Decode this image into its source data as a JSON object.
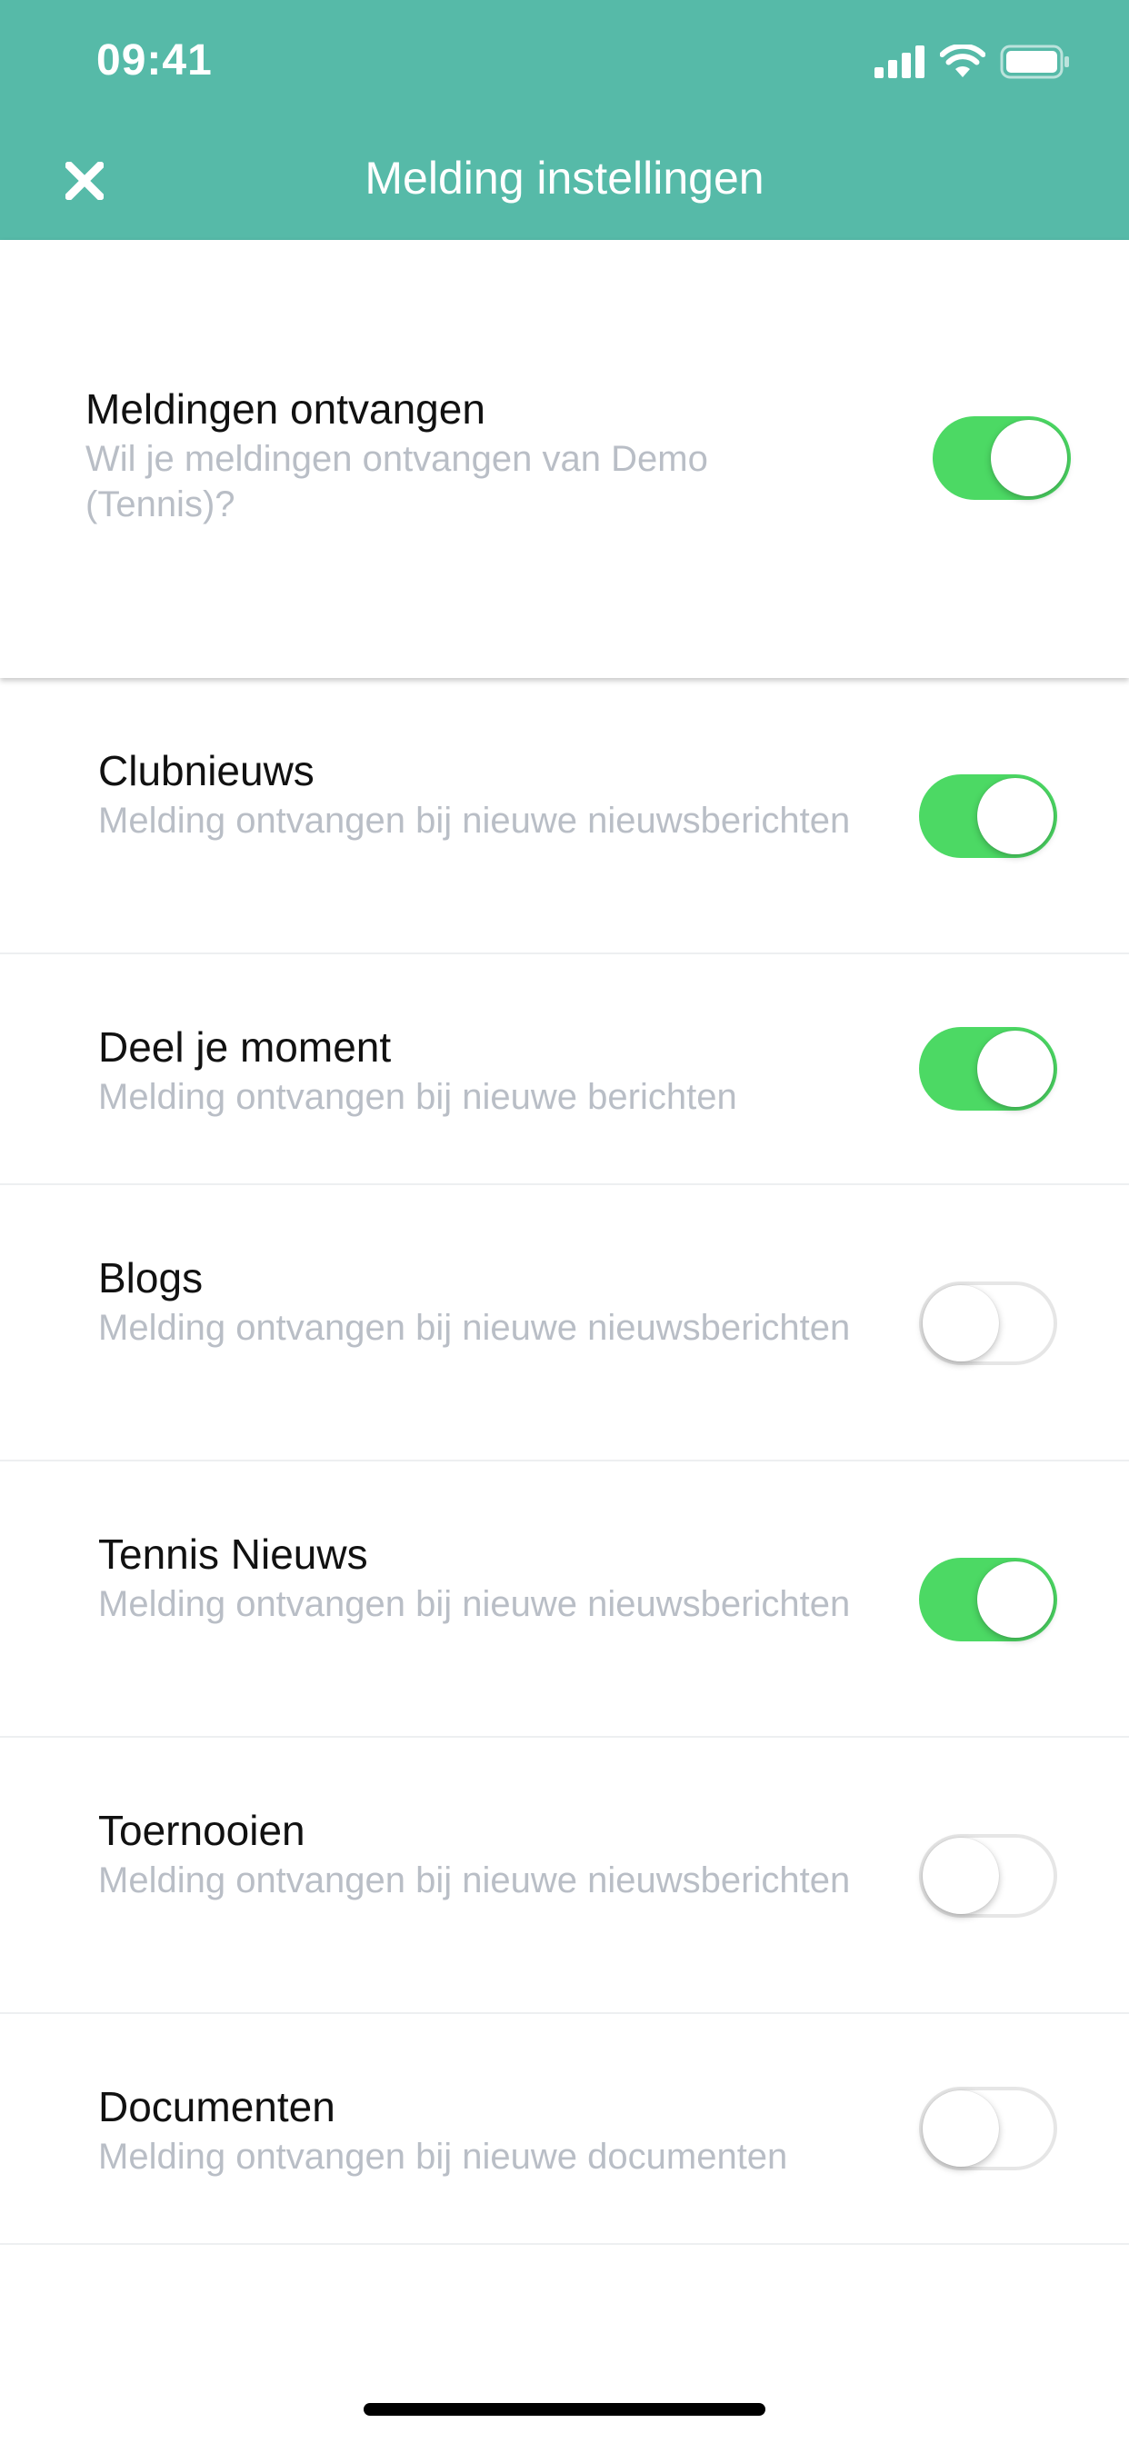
{
  "status_bar": {
    "time": "09:41"
  },
  "header": {
    "title": "Melding instellingen",
    "close_icon": "close-icon"
  },
  "master_setting": {
    "title": "Meldingen ontvangen",
    "description": "Wil je meldingen ontvangen van Demo (Tennis)?",
    "enabled": true
  },
  "settings": [
    {
      "title": "Clubnieuws",
      "description": "Melding ontvangen bij nieuwe nieuwsberichten",
      "enabled": true
    },
    {
      "title": "Deel je moment",
      "description": "Melding ontvangen bij nieuwe berichten",
      "enabled": true
    },
    {
      "title": "Blogs",
      "description": "Melding ontvangen bij nieuwe nieuwsberichten",
      "enabled": false
    },
    {
      "title": "Tennis Nieuws",
      "description": "Melding ontvangen bij nieuwe nieuwsberichten",
      "enabled": true
    },
    {
      "title": "Toernooien",
      "description": "Melding ontvangen bij nieuwe nieuwsberichten",
      "enabled": false
    },
    {
      "title": "Documenten",
      "description": "Melding ontvangen bij nieuwe documenten",
      "enabled": false
    }
  ],
  "colors": {
    "header_bg": "#56BAA8",
    "toggle_on": "#4CD964",
    "toggle_off_border": "#E6E6E6",
    "description_text": "#B9BEC6"
  }
}
